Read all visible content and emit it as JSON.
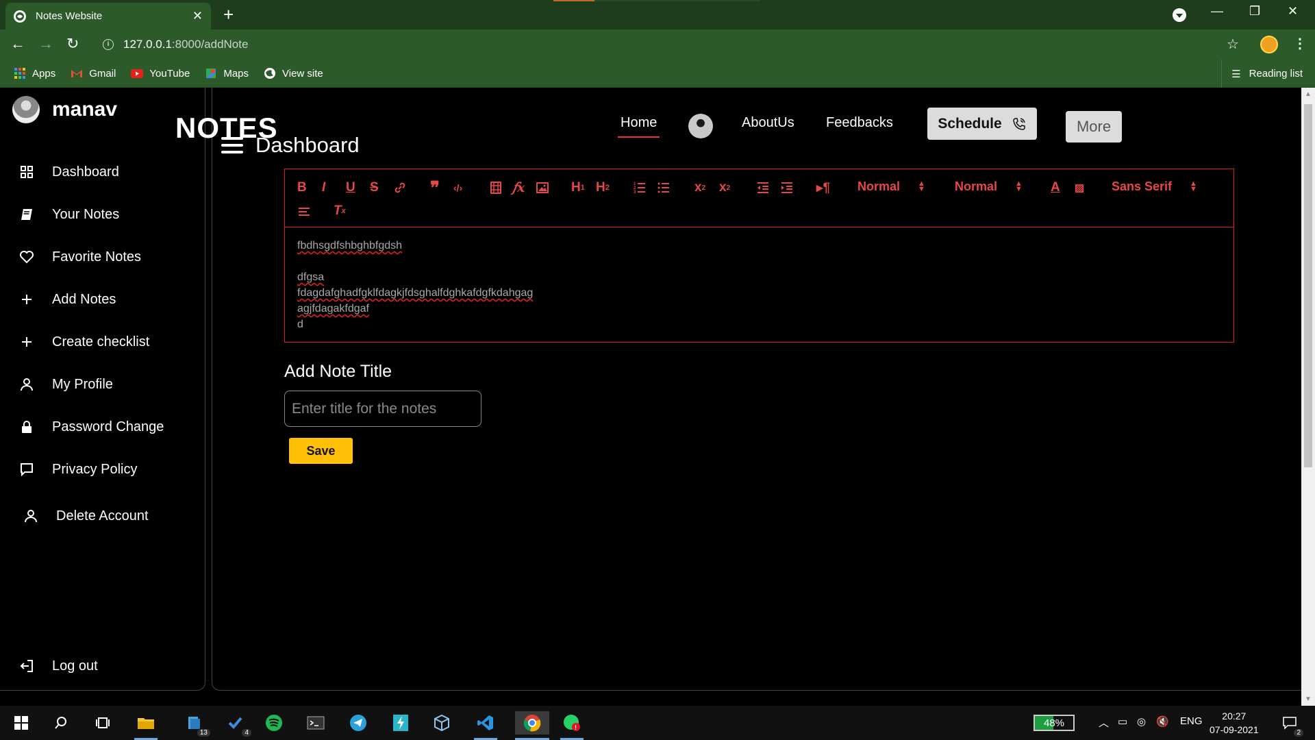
{
  "browser": {
    "tab_title": "Notes Website",
    "url_host": "127.0.0.1",
    "url_path": ":8000/addNote",
    "bookmarks": [
      {
        "label": "Apps",
        "icon": "apps-grid-icon"
      },
      {
        "label": "Gmail",
        "icon": "gmail-icon"
      },
      {
        "label": "YouTube",
        "icon": "youtube-icon"
      },
      {
        "label": "Maps",
        "icon": "maps-icon"
      },
      {
        "label": "View site",
        "icon": "globe-icon"
      }
    ],
    "reading_list": "Reading list"
  },
  "sidebar": {
    "username": "manav",
    "items": [
      {
        "label": "Dashboard",
        "icon": "grid-icon"
      },
      {
        "label": "Your Notes",
        "icon": "book-icon"
      },
      {
        "label": "Favorite Notes",
        "icon": "heart-icon"
      },
      {
        "label": "Add Notes",
        "icon": "plus-icon"
      },
      {
        "label": "Create checklist",
        "icon": "plus-icon"
      },
      {
        "label": "My Profile",
        "icon": "user-icon"
      },
      {
        "label": "Password Change",
        "icon": "lock-icon"
      },
      {
        "label": "Privacy Policy",
        "icon": "message-icon"
      },
      {
        "label": "Delete Account",
        "icon": "user-icon"
      }
    ],
    "logout": "Log out"
  },
  "header": {
    "brand": "NOTES",
    "page_title": "Dashboard",
    "nav": {
      "home": "Home",
      "about": "AboutUs",
      "feedbacks": "Feedbacks"
    },
    "schedule": "Schedule",
    "more": "More"
  },
  "editor": {
    "toolbar": {
      "header_select": "Normal",
      "size_select": "Normal",
      "font_select": "Sans Serif"
    },
    "lines": [
      "fbdhsgdfshbghbfgdsh",
      "",
      "dfgsa",
      "fdagdafghadfgklfdagkjfdsghalfdghkafdgfkdahgag",
      "agjfdagakfdgaf",
      "d"
    ]
  },
  "form": {
    "title_label": "Add Note Title",
    "title_placeholder": "Enter title for the notes",
    "save_label": "Save"
  },
  "taskbar": {
    "battery": "48%",
    "lang": "ENG",
    "time": "20:27",
    "date": "07-09-2021",
    "badge_files": "13",
    "badge_todo": "4",
    "badge_notifications": "2"
  },
  "colors": {
    "accent_red": "#e54848",
    "save_yellow": "#ffc107",
    "chrome_green": "#2c5a2a"
  }
}
